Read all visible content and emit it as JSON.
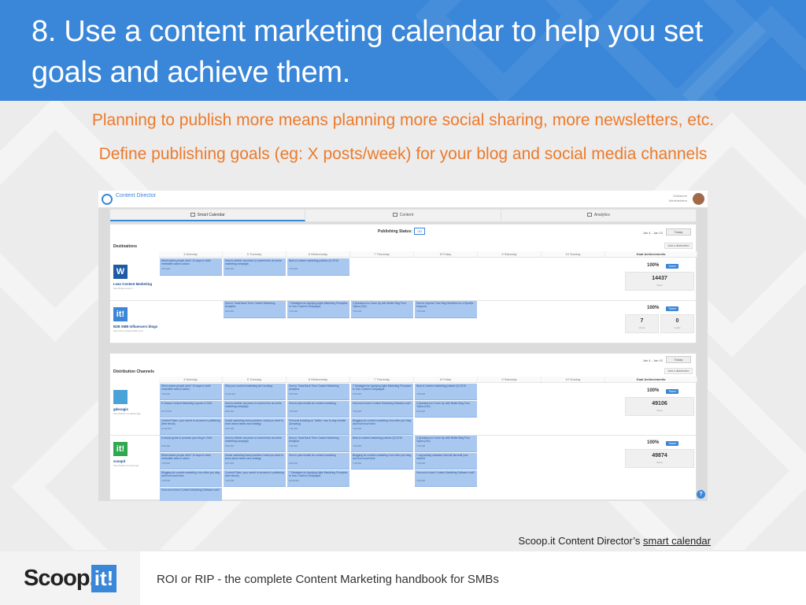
{
  "slide": {
    "title": "8. Use a content marketing calendar to help you set goals and achieve them.",
    "subtitle1": "Planning to publish more means planning more social sharing, more newsletters, etc.",
    "subtitle2": "Define publishing goals (eg: X posts/week) for your blog and social media channels",
    "caption_prefix": "Scoop.it Content Director’s ",
    "caption_link": "smart calendar",
    "footer_logo_a": "Scoop.",
    "footer_logo_b": "it!",
    "footer_text": "ROI or RIP - the complete Content Marketing handbook for SMBs"
  },
  "app": {
    "logo_text": "Content Director",
    "user_name": "Guillaume",
    "user_role": "Administrator",
    "tabs": [
      {
        "label": "Smart Calendar",
        "active": true
      },
      {
        "label": "Content",
        "active": false
      },
      {
        "label": "Analytics",
        "active": false
      }
    ],
    "publishing_status_label": "Publishing Status:",
    "publishing_status_value": "ON",
    "date_range": "Jan 4 - Jan 10",
    "today_label": "Today",
    "days": [
      "4 Monday",
      "5 Tuesday",
      "6 Wednesday",
      "7 Thursday",
      "8 Friday",
      "9 Saturday",
      "10 Sunday"
    ],
    "goal_header": "Goal Achievements",
    "destinations": {
      "title": "Destinations",
      "add_label": "Add a destination",
      "rows": [
        {
          "name": "Lean Content Marketing",
          "url": "http://blog.scoop.it",
          "icon_letter": "W",
          "pct": "100%",
          "tweet": "Tweet",
          "stats": [
            {
              "value": "14437",
              "label": "Views"
            }
          ],
          "cells": [
            {
              "day": 0,
              "slot": 0,
              "text": "What makes people click? 10 ways to write irresistible calls to action",
              "time": "3:00 AM"
            },
            {
              "day": 1,
              "slot": 0,
              "text": "How to rethink one piece of content into an entire marketing campaign",
              "time": "9:00 AM"
            },
            {
              "day": 2,
              "slot": 0,
              "text": "Best of content marketing policies Q4 2015",
              "time": "7:00 AM"
            }
          ]
        },
        {
          "name": "B2B SMB Influencers blogs",
          "url": "http://scoop.it/topic/b2b-smb",
          "icon_letter": "it!",
          "pct": "100%",
          "tweet": "Tweet",
          "stats": [
            {
              "value": "7",
              "label": "Views"
            },
            {
              "value": "0",
              "label": "Leads"
            }
          ],
          "cells": [
            {
              "day": 1,
              "slot": 0,
              "text": "How to Track Back Time Content Marketing Analytics",
              "time": "9:00 AM"
            },
            {
              "day": 2,
              "slot": 0,
              "text": "7 Strategies for Applying Agile Marketing Principles to Your Content Campaigns",
              "time": "7:00 AM"
            },
            {
              "day": 3,
              "slot": 0,
              "text": "3 Questions to Come Up with Better Blog Post Topics (Ok!)",
              "time": "7:00 AM"
            },
            {
              "day": 4,
              "slot": 0,
              "text": "How to Improve Your Blog Workflow for a Specific Keyword",
              "time": "7:00 AM"
            }
          ]
        }
      ]
    },
    "channels": {
      "title": "Distribution Channels",
      "add_label": "Add a distribution",
      "rows": [
        {
          "name": "gdecugis",
          "url": "http://twitter.com/gdecugis",
          "icon_letter": "",
          "pct": "100%",
          "tweet": "Tweet",
          "stats": [
            {
              "value": "49106",
              "label": "Views"
            }
          ],
          "cells": [
            {
              "day": 0,
              "slot": 0,
              "text": "What makes people click? 10 ways to write irresistible calls to action",
              "time": "7:00 AM"
            },
            {
              "day": 0,
              "slot": 1,
              "text": "5 Classic Content Marketing reports of 2015",
              "time": "10:15 PM"
            },
            {
              "day": 0,
              "slot": 2,
              "text": "Content Rules: your secret to success in publishing (free ebook)",
              "time": "11:06 PM"
            },
            {
              "day": 1,
              "slot": 0,
              "text": "Why your content marketing isn't working",
              "time": "11:21 AM"
            },
            {
              "day": 1,
              "slot": 1,
              "text": "How to rethink one piece of content into an entire marketing campaign",
              "time": "8:00 AM"
            },
            {
              "day": 1,
              "slot": 2,
              "text": "Social marketing team practices: what you need to know about teams and strategy",
              "time": "6:21 PM"
            },
            {
              "day": 2,
              "slot": 0,
              "text": "How to Track Back Time Content Marketing Analytics",
              "time": "5:55 AM"
            },
            {
              "day": 2,
              "slot": 1,
              "text": "How to plan emails for content marketing",
              "time": "7:00 AM"
            },
            {
              "day": 2,
              "slot": 2,
              "text": "Personal branding on Twitter: how to stay humble (Amazing)",
              "time": "7:11 PM"
            },
            {
              "day": 3,
              "slot": 0,
              "text": "7 Strategies for Applying Agile Marketing Principles to Your Content Campaigns",
              "time": "6:00 AM"
            },
            {
              "day": 3,
              "slot": 1,
              "text": "How much does Content Marketing Software cost?",
              "time": "7:00 AM"
            },
            {
              "day": 3,
              "slot": 2,
              "text": "Blogging for content marketing: how often you blog and how much time",
              "time": "7:00 AM"
            },
            {
              "day": 4,
              "slot": 0,
              "text": "Best of content marketing policies Q4 2015",
              "time": "7:00 AM"
            },
            {
              "day": 4,
              "slot": 1,
              "text": "3 Questions to Come Up with Better Blog Post Topics (Ok!)",
              "time": "9:30 AM"
            }
          ]
        },
        {
          "name": "scoopit",
          "url": "http://twitter.com/scoopit",
          "icon_letter": "it!",
          "pct": "100%",
          "tweet": "Tweet",
          "stats": [
            {
              "value": "49874",
              "label": "Views"
            }
          ],
          "cells": [
            {
              "day": 0,
              "slot": 0,
              "text": "A simple guide to promote your blog in 2016",
              "time": "6:00 AM"
            },
            {
              "day": 0,
              "slot": 1,
              "text": "What makes people click? 10 ways to write irresistible calls to action",
              "time": "7:00 AM"
            },
            {
              "day": 0,
              "slot": 2,
              "text": "Blogging for content marketing: how often you blog and how much time",
              "time": "7:00 PM"
            },
            {
              "day": 0,
              "slot": 3,
              "text": "How much does Content Marketing Software cost?",
              "time": ""
            },
            {
              "day": 1,
              "slot": 0,
              "text": "How to rethink one piece of content into an entire marketing campaign",
              "time": "8:00 AM"
            },
            {
              "day": 1,
              "slot": 1,
              "text": "Social marketing team practices: what you need to know about teams and strategy",
              "time": "9:27 AM"
            },
            {
              "day": 1,
              "slot": 2,
              "text": "Content Rules: your secret to success in publishing (free ebook)",
              "time": "7:00 PM"
            },
            {
              "day": 2,
              "slot": 0,
              "text": "How to Track Back Time Content Marketing Analytics",
              "time": "7:00 AM"
            },
            {
              "day": 2,
              "slot": 1,
              "text": "How to plan emails for content marketing",
              "time": "9:00 AM"
            },
            {
              "day": 2,
              "slot": 2,
              "text": "7 Strategies for Applying Agile Marketing Principles to Your Content Campaigns",
              "time": "10:00 AM"
            },
            {
              "day": 3,
              "slot": 0,
              "text": "Best of content marketing policies Q4 2015",
              "time": "7:00 AM"
            },
            {
              "day": 3,
              "slot": 1,
              "text": "Blogging for content marketing: how often you blog and how much time",
              "time": "7:00 AM"
            },
            {
              "day": 4,
              "slot": 0,
              "text": "3 Questions to Come Up with Better Blog Post Topics (Ok!)",
              "time": "7:00 AM"
            },
            {
              "day": 4,
              "slot": 1,
              "text": "7 copywriting mistakes that will discredit your content",
              "time": "7:00 AM"
            },
            {
              "day": 4,
              "slot": 2,
              "text": "How much does Content Marketing Software cost?",
              "time": "7:00 AM"
            }
          ]
        }
      ]
    },
    "help_label": "?"
  },
  "colors": {
    "header_blue": "#3a86d8",
    "accent_orange": "#ec7a2c",
    "cell_blue": "#a9c8f0"
  }
}
